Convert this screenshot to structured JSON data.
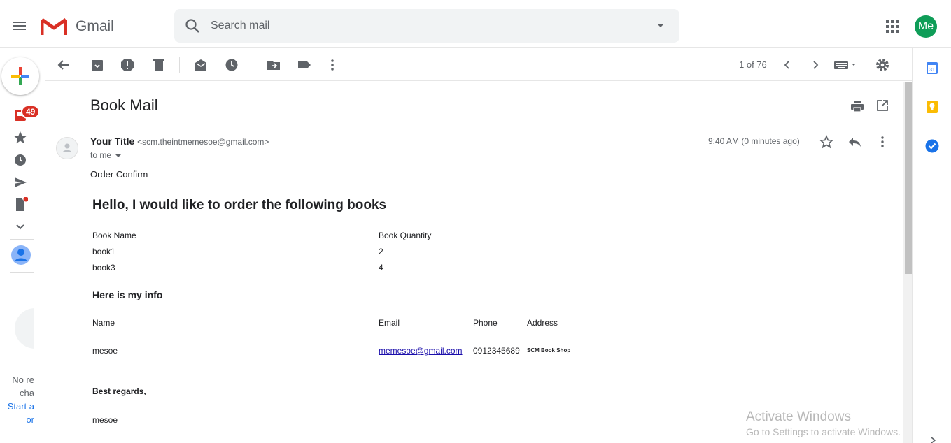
{
  "app": {
    "brand": "Gmail",
    "avatar_initials": "Me"
  },
  "search": {
    "placeholder": "Search mail"
  },
  "left_rail": {
    "inbox_badge": "49",
    "chat_lines": [
      "No re",
      "cha",
      "Start a",
      "or"
    ]
  },
  "toolbar": {
    "pager_text": "1 of 76"
  },
  "message": {
    "subject": "Book Mail",
    "sender_name": "Your Title",
    "sender_email": "<scm.theintmemesoe@gmail.com>",
    "to_label": "to me",
    "time": "9:40 AM (0 minutes ago)",
    "intro": "Order Confirm",
    "heading": "Hello, I would like to order the following books",
    "books_table": {
      "headers": [
        "Book Name",
        "Book Quantity"
      ],
      "rows": [
        [
          "book1",
          "2"
        ],
        [
          "book3",
          "4"
        ]
      ]
    },
    "info_heading": "Here is my info",
    "info_table": {
      "headers": [
        "Name",
        "Email",
        "Phone",
        "Address"
      ],
      "row": [
        "mesoe",
        "memesoe@gmail.com",
        "0912345689",
        "SCM Book Shop"
      ]
    },
    "regards": "Best regards,",
    "signature": "mesoe"
  },
  "watermark": {
    "line1": "Activate Windows",
    "line2": "Go to Settings to activate Windows."
  },
  "icons": {
    "menu": "hamburger-icon",
    "search": "search-icon",
    "back": "arrow-left-icon",
    "archive": "archive-icon",
    "spam": "report-spam-icon",
    "delete": "trash-icon",
    "mark_unread": "mark-unread-icon",
    "snooze": "clock-icon",
    "move": "move-to-icon",
    "label": "label-icon",
    "more": "more-vert-icon",
    "print": "print-icon",
    "new_window": "open-in-new-icon",
    "star": "star-icon",
    "reply": "reply-icon",
    "settings": "gear-icon"
  },
  "colors": {
    "gmail_red": "#d93025",
    "avatar_green": "#0f9d58",
    "link": "#1a0dab",
    "icon_gray": "#5f6368"
  }
}
